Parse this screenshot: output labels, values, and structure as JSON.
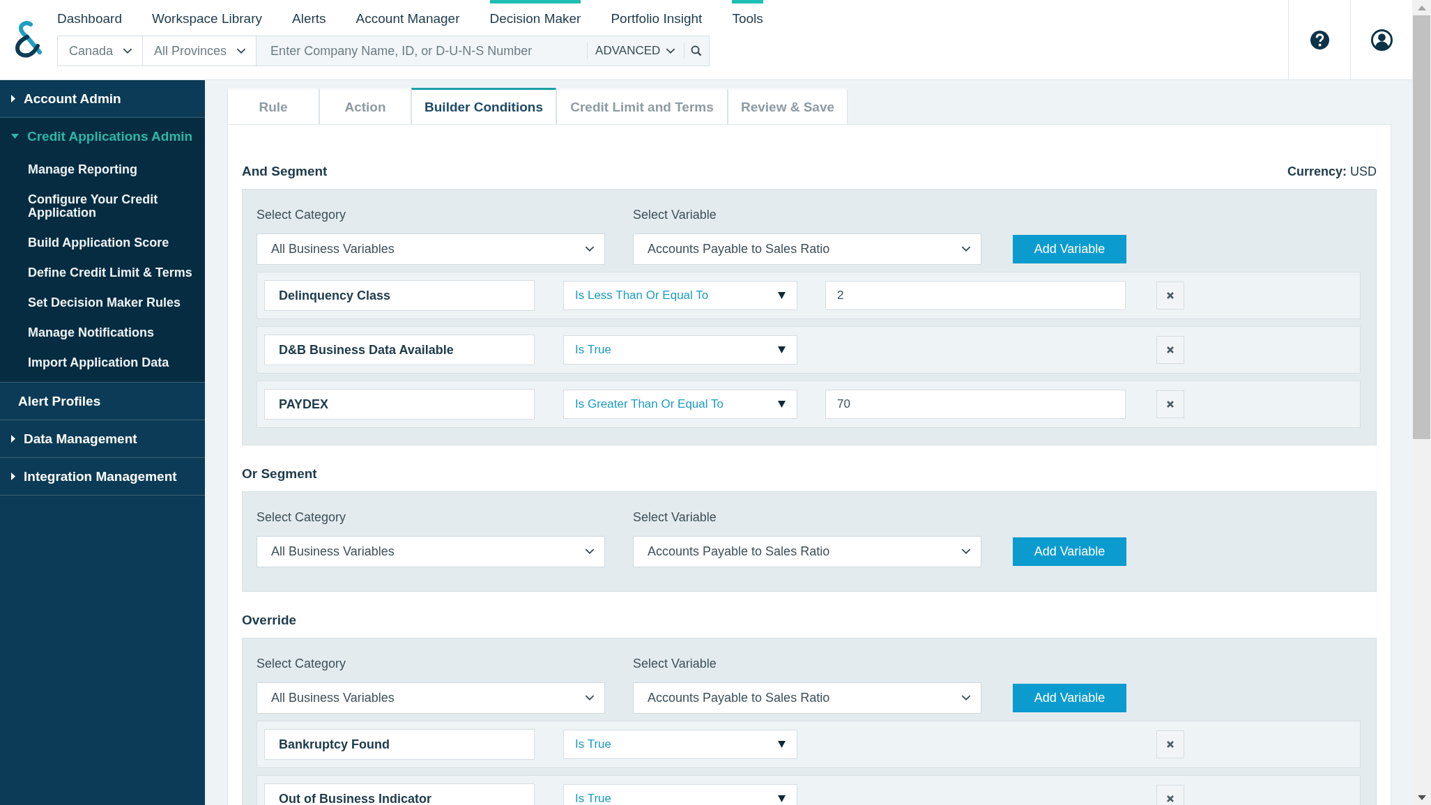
{
  "nav": {
    "items": [
      {
        "label": "Dashboard",
        "selected": false
      },
      {
        "label": "Workspace Library",
        "selected": false
      },
      {
        "label": "Alerts",
        "selected": false
      },
      {
        "label": "Account Manager",
        "selected": false
      },
      {
        "label": "Decision Maker",
        "selected": true
      },
      {
        "label": "Portfolio Insight",
        "selected": false
      },
      {
        "label": "Tools",
        "selected": true
      }
    ]
  },
  "search": {
    "country": "Canada",
    "province": "All Provinces",
    "placeholder": "Enter Company Name, ID, or D-U-N-S Number",
    "advanced": "ADVANCED"
  },
  "sidebar": {
    "items": [
      {
        "label": "Account Admin",
        "kind": "group",
        "expanded": false
      },
      {
        "label": "Credit Applications Admin",
        "kind": "group",
        "expanded": true,
        "children": [
          {
            "label": "Manage Reporting"
          },
          {
            "label": "Configure Your Credit Application"
          },
          {
            "label": "Build Application Score"
          },
          {
            "label": "Define Credit Limit & Terms"
          },
          {
            "label": "Set Decision Maker Rules"
          },
          {
            "label": "Manage Notifications"
          },
          {
            "label": "Import Application Data"
          }
        ]
      },
      {
        "label": "Alert Profiles",
        "kind": "link"
      },
      {
        "label": "Data Management",
        "kind": "group",
        "expanded": false
      },
      {
        "label": "Integration Management",
        "kind": "group",
        "expanded": false
      }
    ]
  },
  "tabs": [
    {
      "label": "Rule",
      "selected": false
    },
    {
      "label": "Action",
      "selected": false
    },
    {
      "label": "Builder Conditions",
      "selected": true
    },
    {
      "label": "Credit Limit and Terms",
      "selected": false
    },
    {
      "label": "Review & Save",
      "selected": false
    }
  ],
  "currency": {
    "label": "Currency:",
    "value": "USD"
  },
  "segments": [
    {
      "title": "And Segment",
      "category_label": "Select Category",
      "category": "All Business Variables",
      "variable_label": "Select Variable",
      "variable": "Accounts Payable to Sales Ratio",
      "button": "Add Variable",
      "conditions": [
        {
          "variable": "Delinquency Class",
          "operator": "Is Less Than Or Equal To",
          "value": "2"
        },
        {
          "variable": "D&B Business Data Available",
          "operator": "Is True"
        },
        {
          "variable": "PAYDEX",
          "operator": "Is Greater Than Or Equal To",
          "value": "70"
        }
      ]
    },
    {
      "title": "Or Segment",
      "category_label": "Select Category",
      "category": "All Business Variables",
      "variable_label": "Select Variable",
      "variable": "Accounts Payable to Sales Ratio",
      "button": "Add Variable"
    },
    {
      "title": "Override",
      "category_label": "Select Category",
      "category": "All Business Variables",
      "variable_label": "Select Variable",
      "variable": "Accounts Payable to Sales Ratio",
      "button": "Add Variable",
      "conditions": [
        {
          "variable": "Bankruptcy Found",
          "operator": "Is True"
        },
        {
          "variable": "Out of Business Indicator",
          "operator": "Is True"
        }
      ]
    }
  ]
}
